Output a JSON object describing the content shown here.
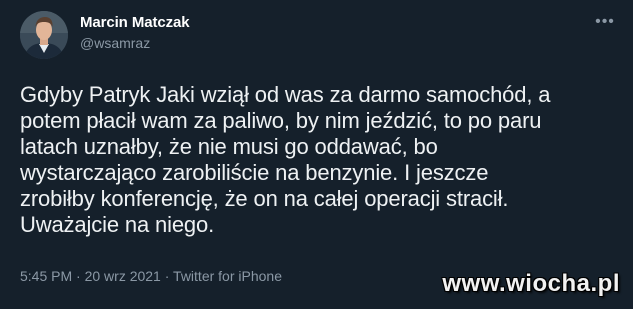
{
  "tweet": {
    "author": {
      "display_name": "Marcin Matczak",
      "handle": "@wsamraz",
      "avatar_icon": "avatar-photo"
    },
    "more_icon": "more-horizontal-icon",
    "more_glyph": "•••",
    "text_lines": [
      "Gdyby Patryk Jaki wziął od was za darmo samochód, a",
      "potem płacił wam za paliwo, by nim jeździć, to po paru",
      "latach uznałby, że nie musi go oddawać, bo",
      "wystarczająco zarobiliście na benzynie. I jeszcze",
      "zrobiłby konferencję, że on na całej operacji stracił.",
      "Uważajcie na niego."
    ],
    "meta": "5:45 PM · 20 wrz 2021 · Twitter for iPhone"
  },
  "watermark": "www.wiocha.pl",
  "colors": {
    "background": "#15202b",
    "text": "#e7e9ea",
    "secondary_text": "#8b98a5"
  }
}
